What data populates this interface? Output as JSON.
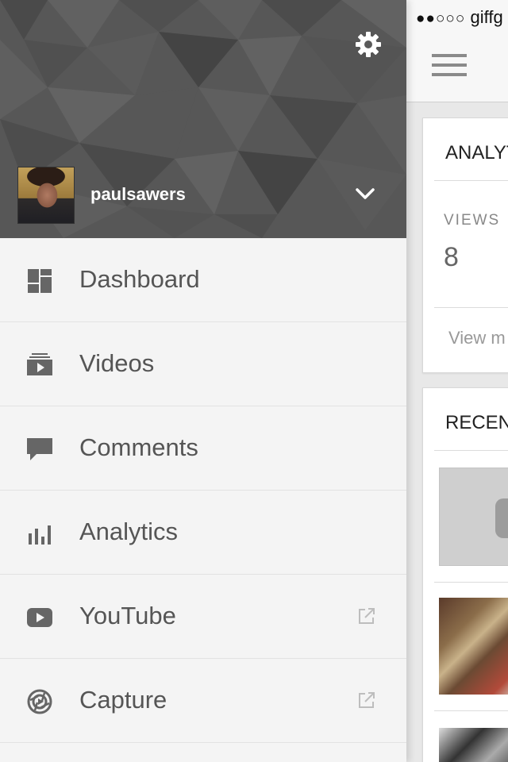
{
  "status_bar": {
    "signal": "●●○○○",
    "carrier": "giffg"
  },
  "drawer": {
    "settings_icon": "gear-icon",
    "account": {
      "username": "paulsawers",
      "chevron_icon": "chevron-down-icon"
    },
    "menu": [
      {
        "label": "Dashboard",
        "icon": "dashboard-icon",
        "external": false
      },
      {
        "label": "Videos",
        "icon": "videos-icon",
        "external": false
      },
      {
        "label": "Comments",
        "icon": "comment-icon",
        "external": false
      },
      {
        "label": "Analytics",
        "icon": "bar-chart-icon",
        "external": false
      },
      {
        "label": "YouTube",
        "icon": "youtube-play-icon",
        "external": true
      },
      {
        "label": "Capture",
        "icon": "capture-icon",
        "external": true
      }
    ]
  },
  "main": {
    "menu_icon": "hamburger-icon",
    "analytics_card": {
      "title": "ANALYT",
      "views_label": "VIEWS",
      "views_value": "8",
      "view_more": "View m"
    },
    "recent_card": {
      "title": "RECEN"
    }
  },
  "colors": {
    "drawer_bg": "#f4f4f4",
    "header_bg": "#555555",
    "menu_text": "#555555",
    "icon_gray": "#666666"
  }
}
